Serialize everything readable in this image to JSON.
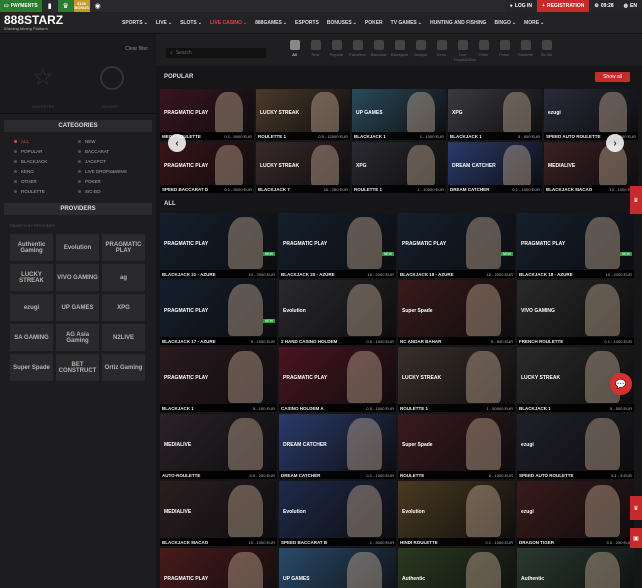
{
  "topbar": {
    "payments_label": "PAYMENTS",
    "bonus_label": "€100 BONUS",
    "login_label": "LOG IN",
    "register_label": "REGISTRATION",
    "time": "09:28",
    "lang": "EN"
  },
  "nav": {
    "logo_main": "888STARZ",
    "logo_sub": "iGaming Mining Platform",
    "items": [
      {
        "label": "SPORTS"
      },
      {
        "label": "LIVE"
      },
      {
        "label": "SLOTS"
      },
      {
        "label": "LIVE CASINO"
      },
      {
        "label": "888GAMES"
      },
      {
        "label": "ESPORTS"
      },
      {
        "label": "BONUSES"
      },
      {
        "label": "POKER"
      },
      {
        "label": "TV GAMES"
      },
      {
        "label": "HUNTING AND FISHING"
      },
      {
        "label": "BINGO"
      },
      {
        "label": "MORE"
      }
    ]
  },
  "sidebar": {
    "clear_filter": "Clear filter",
    "favorites_label": "FAVORITES",
    "recent_label": "RECENT",
    "categories_title": "CATEGORIES",
    "categories": [
      {
        "label": "ALL"
      },
      {
        "label": "NEW"
      },
      {
        "label": "POPULAR"
      },
      {
        "label": "BACCARAT"
      },
      {
        "label": "BLACKJACK"
      },
      {
        "label": "JACKPOT"
      },
      {
        "label": "KENO"
      },
      {
        "label": "LIVE DROPS&WINS"
      },
      {
        "label": "OTHER"
      },
      {
        "label": "POKER"
      },
      {
        "label": "ROULETTE"
      },
      {
        "label": "SIC-BO"
      }
    ],
    "providers_title": "PROVIDERS",
    "provider_search": "SEARCH BY PROVIDER",
    "providers": [
      {
        "label": "Authentic Gaming"
      },
      {
        "label": "Evolution"
      },
      {
        "label": "PRAGMATIC PLAY"
      },
      {
        "label": "LUCKY STREAK"
      },
      {
        "label": "VIVO GAMING"
      },
      {
        "label": "ag"
      },
      {
        "label": "ezugi"
      },
      {
        "label": "UP GAMES"
      },
      {
        "label": "XPG"
      },
      {
        "label": "SA GAMING"
      },
      {
        "label": "AG Asia Gaming"
      },
      {
        "label": "N2LIVE"
      },
      {
        "label": "Super Spade"
      },
      {
        "label": "BET CONSTRUCT"
      },
      {
        "label": "Ortiz Gaming"
      }
    ]
  },
  "main": {
    "search_placeholder": "Search",
    "filters": [
      {
        "label": "All"
      },
      {
        "label": "New"
      },
      {
        "label": "Popular"
      },
      {
        "label": "Favorites"
      },
      {
        "label": "Baccarat"
      },
      {
        "label": "Blackjack"
      },
      {
        "label": "Jackpot"
      },
      {
        "label": "Keno"
      },
      {
        "label": "Live Drops&Wins"
      },
      {
        "label": "Other"
      },
      {
        "label": "Poker"
      },
      {
        "label": "Roulette"
      },
      {
        "label": "Sic-Bo"
      }
    ],
    "popular_title": "POPULAR",
    "show_all": "Show all",
    "all_title": "ALL",
    "popular": [
      {
        "name": "MEGA ROULETTE",
        "limits": "0.1 - 5000 EUR",
        "brand": "PRAGMATIC PLAY",
        "bg": "#3a1420"
      },
      {
        "name": "ROULETTE 1",
        "limits": "0.5 - 12000 EUR",
        "brand": "LUCKY STREAK",
        "bg": "#4a3a2a"
      },
      {
        "name": "BLACKJACK 1",
        "limits": "1 - 1000 EUR",
        "brand": "UP GAMES",
        "bg": "#2a4a5a"
      },
      {
        "name": "BLACKJACK 1",
        "limits": "5 - 500 EUR",
        "brand": "XPG",
        "bg": "#3a3a40"
      },
      {
        "name": "SPEED AUTO ROULETTE",
        "limits": "1 - 1000 EUR",
        "brand": "ezugi",
        "bg": "#2a2a3a"
      },
      {
        "name": "SPEED BACCARAT D",
        "limits": "0.1 - 5000 EUR",
        "brand": "PRAGMATIC PLAY",
        "bg": "#3a1418"
      },
      {
        "name": "BLACKJACK 7",
        "limits": "10 - 250 EUR",
        "brand": "LUCKY STREAK",
        "bg": "#3a2a2a"
      },
      {
        "name": "ROULETTE 1",
        "limits": "1 - 10000 EUR",
        "brand": "XPG",
        "bg": "#2a2a30"
      },
      {
        "name": "DREAM CATCHER",
        "limits": "0.1 - 1000 EUR",
        "brand": "DREAM CATCHER",
        "bg": "#2a3a6a"
      },
      {
        "name": "BLACKJACK MACAO",
        "limits": "10 - 1000 EUR",
        "brand": "MEDIALIVE",
        "bg": "#3a2020"
      }
    ],
    "all": [
      {
        "name": "BLACKJACK 21 - AZURE",
        "limits": "10 - 2000 EUR",
        "brand": "PRAGMATIC PLAY",
        "bg": "#15202e",
        "isnew": "NEW"
      },
      {
        "name": "BLACKJACK 20 - AZURE",
        "limits": "10 - 2000 EUR",
        "brand": "PRAGMATIC PLAY",
        "bg": "#15202e",
        "isnew": "NEW"
      },
      {
        "name": "BLACKJACK 19 - AZURE",
        "limits": "10 - 2000 EUR",
        "brand": "PRAGMATIC PLAY",
        "bg": "#15202e",
        "isnew": "NEW"
      },
      {
        "name": "BLACKJACK 18 - AZURE",
        "limits": "10 - 2000 EUR",
        "brand": "PRAGMATIC PLAY",
        "bg": "#15202e",
        "isnew": "NEW"
      },
      {
        "name": "BLACKJACK 17 - AZURE",
        "limits": "5 - 1000 EUR",
        "brand": "PRAGMATIC PLAY",
        "bg": "#15202e",
        "isnew": "NEW"
      },
      {
        "name": "2 HAND CASINO HOLDEM",
        "limits": "0.5 - 1000 EUR",
        "brand": "Evolution",
        "bg": "#2a2a2e",
        "isnew": ""
      },
      {
        "name": "NC ANDAR BAHAR",
        "limits": "5 - 500 EUR",
        "brand": "Super Spade",
        "bg": "#3a1a1a",
        "isnew": ""
      },
      {
        "name": "FRENCH ROULETTE",
        "limits": "0.1 - 1000 EUR",
        "brand": "VIVO GAMING",
        "bg": "#2a2a2a",
        "isnew": ""
      },
      {
        "name": "BLACKJACK 1",
        "limits": "5 - 100 EUR",
        "brand": "PRAGMATIC PLAY",
        "bg": "#2a1a20",
        "isnew": ""
      },
      {
        "name": "CASINO HOLDEM A",
        "limits": "0.5 - 1000 EUR",
        "brand": "PRAGMATIC PLAY",
        "bg": "#4a1420",
        "isnew": ""
      },
      {
        "name": "ROULETTE 1",
        "limits": "1 - 50000 EUR",
        "brand": "LUCKY STREAK",
        "bg": "#3a302a",
        "isnew": ""
      },
      {
        "name": "BLACKJACK 1",
        "limits": "5 - 500 EUR",
        "brand": "LUCKY STREAK",
        "bg": "#2a2a2a",
        "isnew": ""
      },
      {
        "name": "AUTO-ROULETTE",
        "limits": "0.5 - 200 EUR",
        "brand": "MEDIALIVE",
        "bg": "#2a2228",
        "isnew": ""
      },
      {
        "name": "DREAM CATCHER",
        "limits": "0.1 - 1000 EUR",
        "brand": "DREAM CATCHER",
        "bg": "#2a3a6a",
        "isnew": ""
      },
      {
        "name": "ROULETTE",
        "limits": "5 - 1000 EUR",
        "brand": "Super Spade",
        "bg": "#3a1a1e",
        "isnew": ""
      },
      {
        "name": "SPEED AUTO ROULETTE",
        "limits": "0.1 - 5 EUR",
        "brand": "ezugi",
        "bg": "#20202a",
        "isnew": ""
      },
      {
        "name": "BLACKJACK MACAO",
        "limits": "10 - 1000 EUR",
        "brand": "MEDIALIVE",
        "bg": "#2a1e20",
        "isnew": ""
      },
      {
        "name": "SPEED BACCARAT B",
        "limits": "1 - 5000 EUR",
        "brand": "Evolution",
        "bg": "#1e2a4a",
        "isnew": ""
      },
      {
        "name": "HINDI ROULETTE",
        "limits": "0.1 - 1000 EUR",
        "brand": "Evolution",
        "bg": "#4a3a20",
        "isnew": ""
      },
      {
        "name": "DRAGON TIGER",
        "limits": "0.5 - 200 EUR",
        "brand": "ezugi",
        "bg": "#3a1a1a",
        "isnew": ""
      },
      {
        "name": "",
        "limits": "",
        "brand": "PRAGMATIC PLAY",
        "bg": "#4a1a1a",
        "isnew": ""
      },
      {
        "name": "",
        "limits": "",
        "brand": "UP GAMES",
        "bg": "#2a4a6a",
        "isnew": ""
      },
      {
        "name": "",
        "limits": "",
        "brand": "Authentic",
        "bg": "#2a3a20",
        "isnew": ""
      },
      {
        "name": "",
        "limits": "",
        "brand": "Authentic",
        "bg": "#2a3a30",
        "isnew": ""
      }
    ]
  }
}
